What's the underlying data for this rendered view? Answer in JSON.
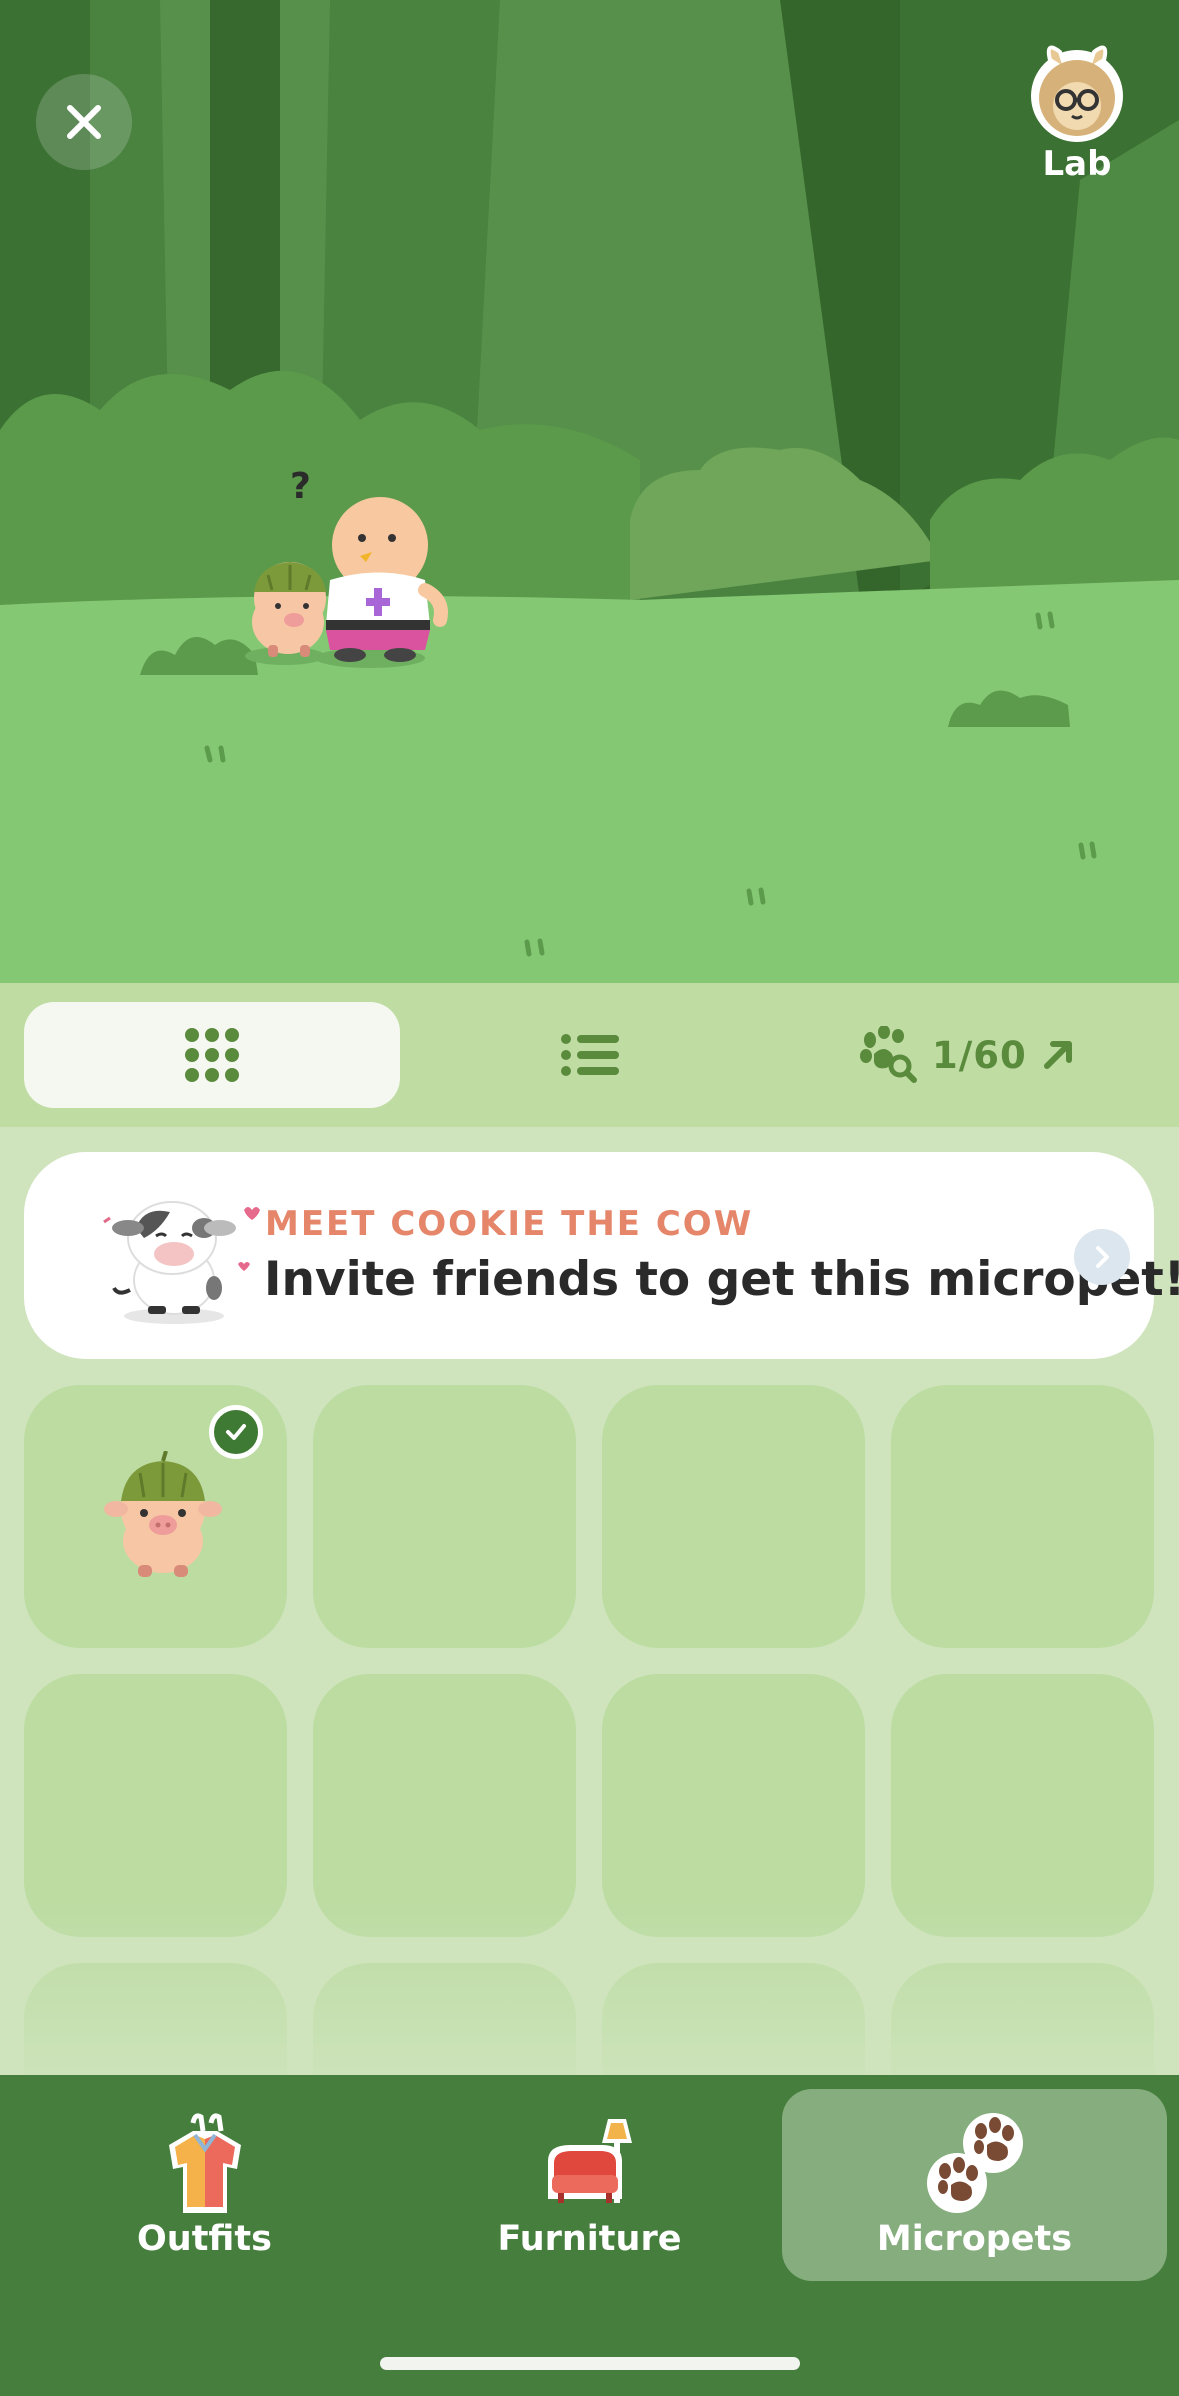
{
  "header": {
    "lab_label": "Lab"
  },
  "scene": {
    "speech_mark": "?"
  },
  "toolbar": {
    "grid_view_icon": "grid-icon",
    "list_view_icon": "list-icon",
    "collection_icon": "paw-search-icon",
    "collection_count": "1/60",
    "collection_arrow_icon": "arrow-up-right-icon"
  },
  "promo": {
    "kicker": "MEET COOKIE THE COW",
    "title": "Invite friends to get this micropet!",
    "arrow_icon": "chevron-right-icon"
  },
  "micropets": {
    "owned_pet": "pig-with-leaf-hat",
    "selected_badge_icon": "check-icon"
  },
  "tabs": [
    {
      "label": "Outfits",
      "icon": "outfit-icon",
      "active": false
    },
    {
      "label": "Furniture",
      "icon": "furniture-icon",
      "active": false
    },
    {
      "label": "Micropets",
      "icon": "paws-icon",
      "active": true
    }
  ],
  "colors": {
    "forest_dark": "#3f7535",
    "grass": "#84c874",
    "toolbar_bg": "#bfdca3",
    "cell_bg": "#bcdca2",
    "tabbar_bg": "#467e3d",
    "accent_text": "#5a8a3c",
    "promo_kicker": "#e5866a"
  }
}
